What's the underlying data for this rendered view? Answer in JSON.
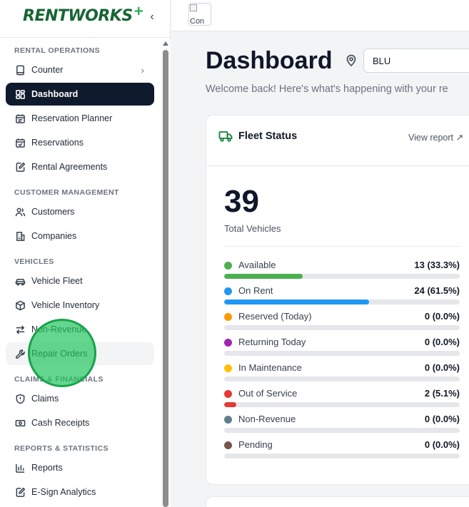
{
  "sidebar": {
    "logo": "RENTWORKS",
    "logo_plus": "+",
    "collapse_icon": "chevron-left-icon",
    "sections": {
      "rental_operations": "RENTAL OPERATIONS",
      "customer_management": "CUSTOMER MANAGEMENT",
      "vehicles": "VEHICLES",
      "claims_financials": "CLAIMS & FINANCIALS",
      "reports_statistics": "REPORTS & STATISTICS"
    },
    "items": {
      "counter": "Counter",
      "dashboard": "Dashboard",
      "reservation_planner": "Reservation Planner",
      "reservations": "Reservations",
      "rental_agreements": "Rental Agreements",
      "customers": "Customers",
      "companies": "Companies",
      "vehicle_fleet": "Vehicle Fleet",
      "vehicle_inventory": "Vehicle Inventory",
      "non_revenue": "Non-Revenue",
      "repair_orders": "Repair Orders",
      "claims": "Claims",
      "cash_receipts": "Cash Receipts",
      "reports": "Reports",
      "esign_analytics": "E-Sign Analytics"
    }
  },
  "topbar": {
    "avatar_alt": "Con"
  },
  "main": {
    "title": "Dashboard",
    "location_value": "BLU",
    "welcome": "Welcome back! Here's what's happening with your re"
  },
  "fleet": {
    "title": "Fleet Status",
    "view_report": "View report",
    "total": "39",
    "total_label": "Total Vehicles",
    "statuses": [
      {
        "label": "Available",
        "value": "13 (33.3%)",
        "fraction": 0.333,
        "color": "#4caf50"
      },
      {
        "label": "On Rent",
        "value": "24 (61.5%)",
        "fraction": 0.615,
        "color": "#2196f3"
      },
      {
        "label": "Reserved (Today)",
        "value": "0 (0.0%)",
        "fraction": 0,
        "color": "#ff9800"
      },
      {
        "label": "Returning Today",
        "value": "0 (0.0%)",
        "fraction": 0,
        "color": "#9c27b0"
      },
      {
        "label": "In Maintenance",
        "value": "0 (0.0%)",
        "fraction": 0,
        "color": "#ffc107"
      },
      {
        "label": "Out of Service",
        "value": "2 (5.1%)",
        "fraction": 0.051,
        "color": "#e53935"
      },
      {
        "label": "Non-Revenue",
        "value": "0 (0.0%)",
        "fraction": 0,
        "color": "#607d8b"
      },
      {
        "label": "Pending",
        "value": "0 (0.0%)",
        "fraction": 0,
        "color": "#795548"
      }
    ]
  }
}
